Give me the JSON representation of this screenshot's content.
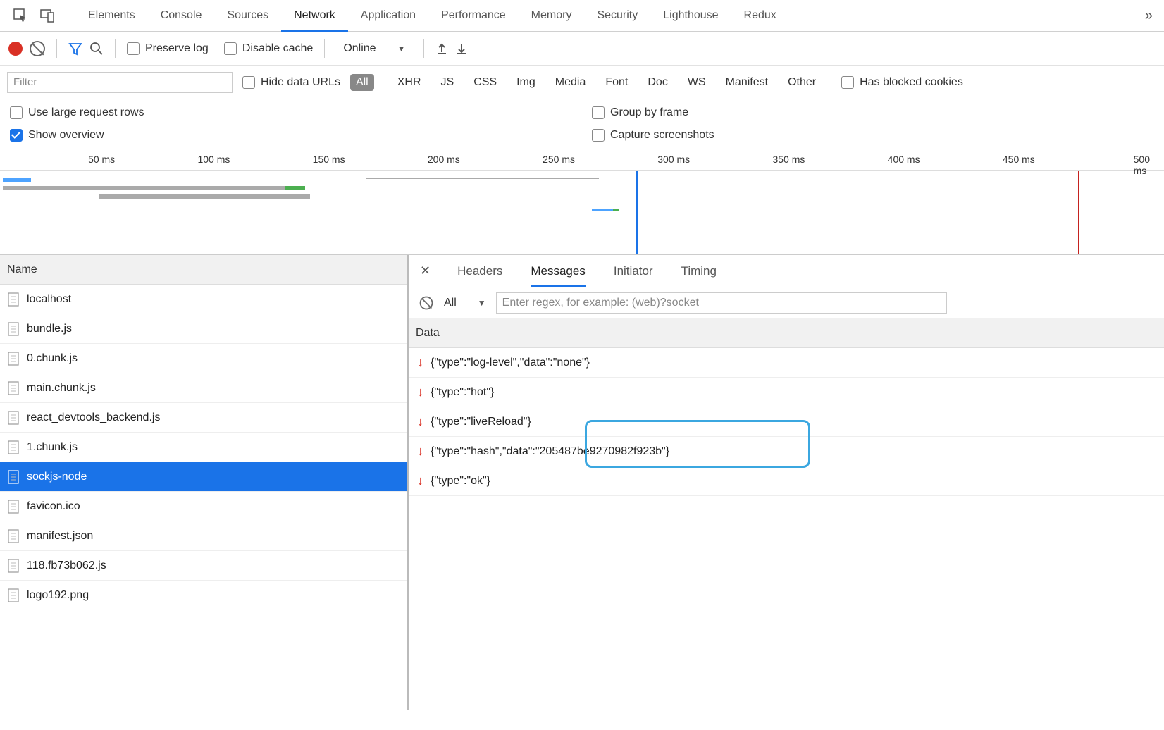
{
  "tabs": [
    "Elements",
    "Console",
    "Sources",
    "Network",
    "Application",
    "Performance",
    "Memory",
    "Security",
    "Lighthouse",
    "Redux"
  ],
  "active_tab": "Network",
  "toolbar": {
    "preserve_log": "Preserve log",
    "disable_cache": "Disable cache",
    "throttling": "Online"
  },
  "filter_row": {
    "filter_placeholder": "Filter",
    "hide_data_urls": "Hide data URLs",
    "types": [
      "All",
      "XHR",
      "JS",
      "CSS",
      "Img",
      "Media",
      "Font",
      "Doc",
      "WS",
      "Manifest",
      "Other"
    ],
    "active_type": "All",
    "has_blocked_cookies": "Has blocked cookies"
  },
  "options": {
    "large_rows": "Use large request rows",
    "show_overview": "Show overview",
    "group_by_frame": "Group by frame",
    "capture_screenshots": "Capture screenshots"
  },
  "timeline": {
    "ticks": [
      "50 ms",
      "100 ms",
      "150 ms",
      "200 ms",
      "250 ms",
      "300 ms",
      "350 ms",
      "400 ms",
      "450 ms",
      "500 ms"
    ]
  },
  "request_panel": {
    "header": "Name",
    "items": [
      "localhost",
      "bundle.js",
      "0.chunk.js",
      "main.chunk.js",
      "react_devtools_backend.js",
      "1.chunk.js",
      "sockjs-node",
      "favicon.ico",
      "manifest.json",
      "118.fb73b062.js",
      "logo192.png"
    ],
    "selected": "sockjs-node"
  },
  "detail": {
    "tabs": [
      "Headers",
      "Messages",
      "Initiator",
      "Timing"
    ],
    "active": "Messages",
    "filter_all": "All",
    "regex_placeholder": "Enter regex, for example: (web)?socket",
    "data_header": "Data",
    "messages": [
      "{\"type\":\"log-level\",\"data\":\"none\"}",
      "{\"type\":\"hot\"}",
      "{\"type\":\"liveReload\"}",
      "{\"type\":\"hash\",\"data\":\"205487be9270982f923b\"}",
      "{\"type\":\"ok\"}"
    ],
    "highlight_index": 3
  }
}
